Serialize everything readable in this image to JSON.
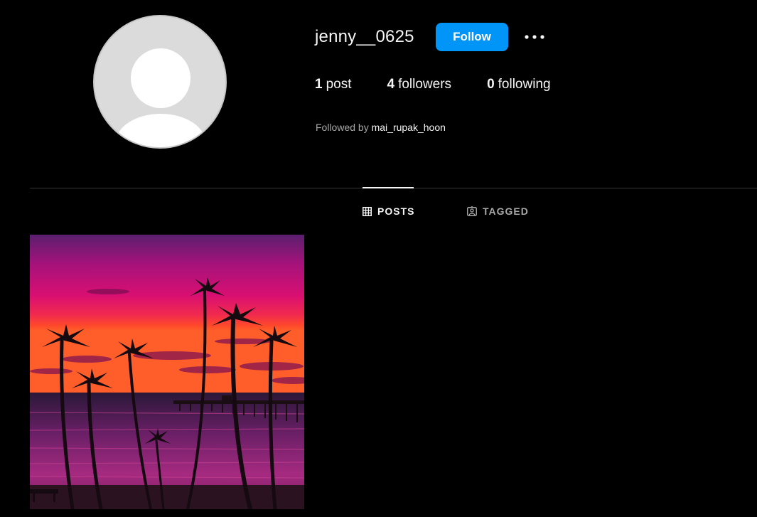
{
  "profile": {
    "username": "jenny__0625",
    "follow_label": "Follow",
    "stats": [
      {
        "count": "1",
        "label": "post"
      },
      {
        "count": "4",
        "label": "followers"
      },
      {
        "count": "0",
        "label": "following"
      }
    ],
    "followed_by_prefix": "Followed by",
    "followed_by_user": "mai_rupak_hoon"
  },
  "tabs": [
    {
      "label": "POSTS",
      "icon": "grid-icon",
      "active": true
    },
    {
      "label": "TAGGED",
      "icon": "tagged-icon",
      "active": false
    }
  ],
  "posts": [
    {
      "description": "palm trees silhouette sunset pier"
    }
  ],
  "colors": {
    "background": "#000000",
    "accent": "#0095f6",
    "text": "#f5f5f5",
    "muted": "#a8a8a8"
  }
}
